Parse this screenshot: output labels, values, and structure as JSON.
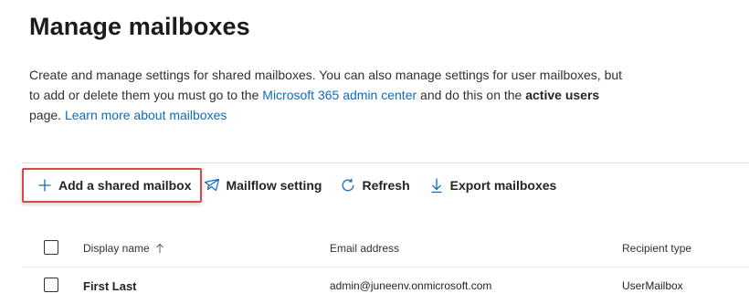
{
  "page": {
    "title": "Manage mailboxes",
    "description": {
      "part1": "Create and manage settings for shared mailboxes. You can also manage settings for user mailboxes, but to add or delete them you must go to the ",
      "admin_center_link": "Microsoft 365 admin center",
      "part2": " and do this on the ",
      "active_users": "active users",
      "part3": " page. ",
      "learn_more_link": "Learn more about mailboxes"
    }
  },
  "toolbar": {
    "add_shared": {
      "label": "Add a shared mailbox",
      "icon": "plus-icon"
    },
    "mailflow": {
      "label": "Mailflow setting",
      "icon": "mail-send-icon"
    },
    "refresh": {
      "label": "Refresh",
      "icon": "refresh-icon"
    },
    "export": {
      "label": "Export mailboxes",
      "icon": "download-arrow-icon"
    },
    "highlight_color": "#d9474a"
  },
  "table": {
    "columns": {
      "display_name": "Display name",
      "display_name_sort": "ascending",
      "email": "Email address",
      "recipient_type": "Recipient type"
    },
    "rows": [
      {
        "display_name": "First Last",
        "email": "admin@juneenv.onmicrosoft.com",
        "recipient_type": "UserMailbox"
      }
    ]
  },
  "colors": {
    "link": "#0f6cbd",
    "text": "#242424"
  }
}
